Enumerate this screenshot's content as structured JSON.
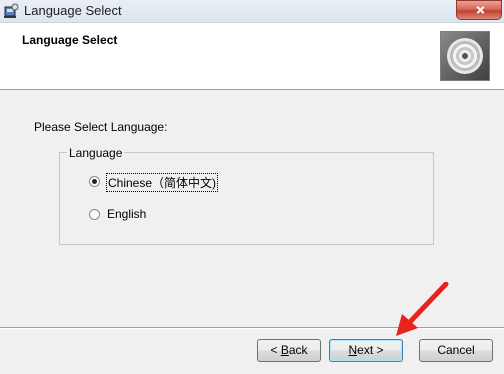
{
  "window": {
    "title": "Language Select"
  },
  "header": {
    "title": "Language Select"
  },
  "main": {
    "prompt": "Please Select Language:",
    "group_label": "Language",
    "options": [
      {
        "label": "Chinese（简体中文)",
        "checked": true
      },
      {
        "label": "English",
        "checked": false
      }
    ]
  },
  "buttons": {
    "back": {
      "arrow": "< ",
      "accel": "B",
      "rest": "ack"
    },
    "next": {
      "accel": "N",
      "rest": "ext",
      "arrow": " >"
    },
    "cancel": "Cancel"
  },
  "annotation": {
    "arrow_color": "#e8231b"
  }
}
